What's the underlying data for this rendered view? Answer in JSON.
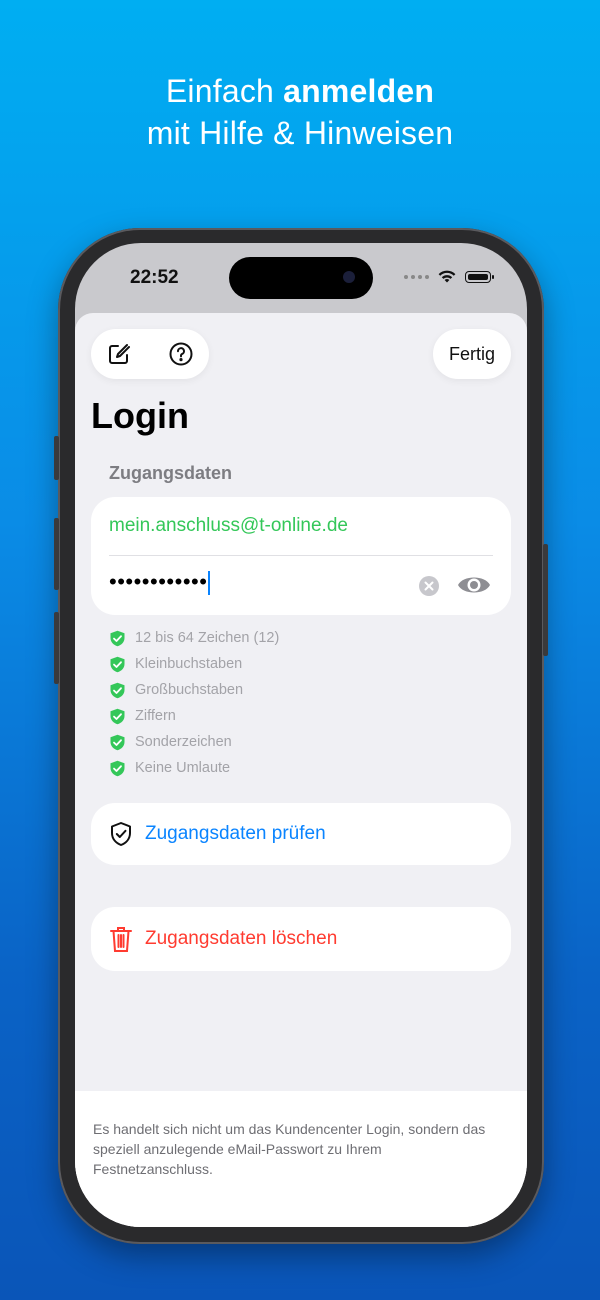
{
  "headline": {
    "light": "Einfach",
    "bold": "anmelden",
    "line2": "mit Hilfe & Hinweisen"
  },
  "status": {
    "time": "22:52"
  },
  "toolbar": {
    "edit_icon": "edit-icon",
    "help_icon": "help-icon",
    "done_label": "Fertig"
  },
  "page": {
    "title": "Login",
    "section": "Zugangsdaten"
  },
  "credentials": {
    "email": "mein.anschluss@t-online.de",
    "password_masked": "••••••••••••"
  },
  "rules": [
    {
      "label": "12 bis 64 Zeichen (12)",
      "ok": true
    },
    {
      "label": "Kleinbuchstaben",
      "ok": true
    },
    {
      "label": "Großbuchstaben",
      "ok": true
    },
    {
      "label": "Ziffern",
      "ok": true
    },
    {
      "label": "Sonderzeichen",
      "ok": true
    },
    {
      "label": "Keine Umlaute",
      "ok": true
    }
  ],
  "actions": {
    "check_label": "Zugangsdaten prüfen",
    "delete_label": "Zugangsdaten löschen"
  },
  "footer": {
    "text": "Es handelt sich nicht um das Kundencenter Login, sondern das speziell anzulegende eMail-Passwort zu Ihrem Festnetzanschluss."
  },
  "colors": {
    "accent": "#0a84ff",
    "success": "#34c759",
    "danger": "#ff3b30",
    "background_top": "#00aef2",
    "background_bottom": "#0a55b8"
  }
}
